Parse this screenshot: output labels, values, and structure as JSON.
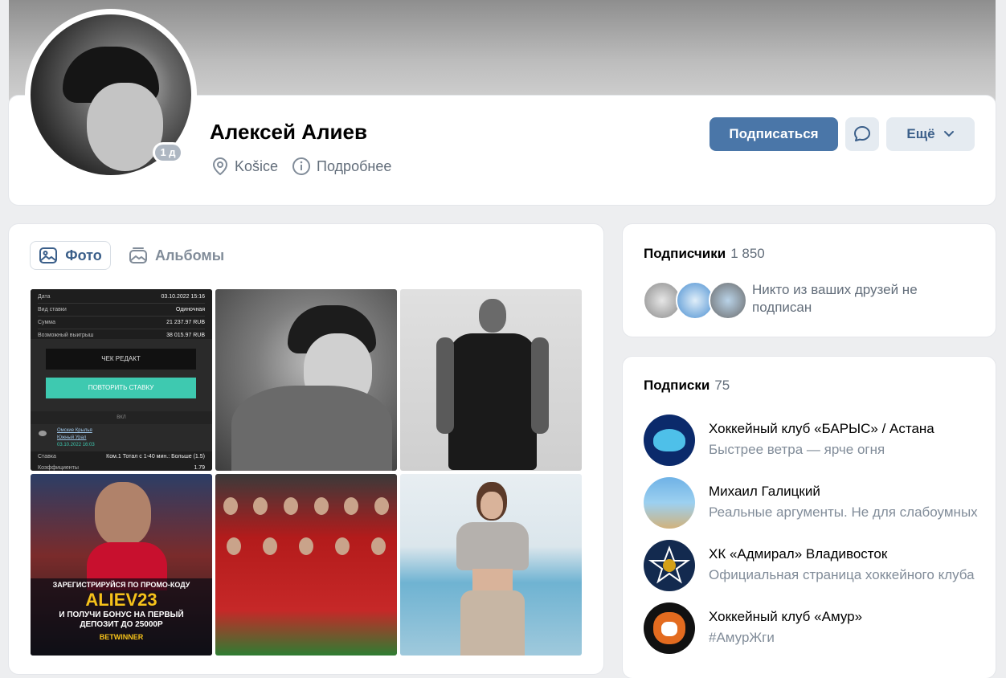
{
  "profile": {
    "name": "Алексей Алиев",
    "last_seen": "1 д",
    "city": "Košice",
    "details_label": "Подробнее",
    "subscribe_label": "Подписаться",
    "more_label": "Ещё"
  },
  "photos": {
    "tabs": [
      {
        "label": "Фото"
      },
      {
        "label": "Альбомы"
      }
    ],
    "bet_slip": {
      "rows": [
        {
          "key": "Дата",
          "value": "03.10.2022 15:16"
        },
        {
          "key": "Вид ставки",
          "value": "Одиночная"
        },
        {
          "key": "Сумма",
          "value": "21 237.97 RUB"
        },
        {
          "key": "Возможный выигрыш",
          "value": "38 015.97 RUB"
        }
      ],
      "check_button": "ЧЕК РЕДАКТ",
      "repeat_button": "ПОВТОРИТЬ СТАВКУ",
      "expand_label": "ВКЛ",
      "teams": "Омские Крылья",
      "teams2": "Южный Урал",
      "event_date": "03.10.2022 16:03",
      "stake_label": "Ставка",
      "stake_value": "Ком.1 Тотал с 1-40 мин.: Больше (1.5)",
      "coef_label": "Коэффициенты",
      "coef_value": "1.79"
    },
    "promo": {
      "line1": "ЗАРЕГИСТРИРУЙСЯ ПО ПРОМО-КОДУ",
      "code": "ALIEV23",
      "line2": "И ПОЛУЧИ БОНУС НА ПЕРВЫЙ",
      "line3": "ДЕПОЗИТ ДО 25000Р",
      "brand": "BETWINNER"
    }
  },
  "followers": {
    "title": "Подписчики",
    "count": "1 850",
    "no_friends_text": "Никто из ваших друзей не подписан"
  },
  "subscriptions": {
    "title": "Подписки",
    "count": "75",
    "items": [
      {
        "name": "Хоккейный клуб «БАРЫС» / Астана",
        "desc": "Быстрее ветра — ярче огня"
      },
      {
        "name": "Михаил Галицкий",
        "desc": "Реальные аргументы. Не для слабоумных"
      },
      {
        "name": "ХК «Адмирал» Владивосток",
        "desc": "Официальная страница хоккейного клуба"
      },
      {
        "name": "Хоккейный клуб «Амур»",
        "desc": "#АмурЖги"
      }
    ]
  },
  "colors": {
    "accent": "#4a76a8",
    "secondary_button": "#e5ebf1",
    "muted_text": "#818c99",
    "background": "#edeef0"
  }
}
